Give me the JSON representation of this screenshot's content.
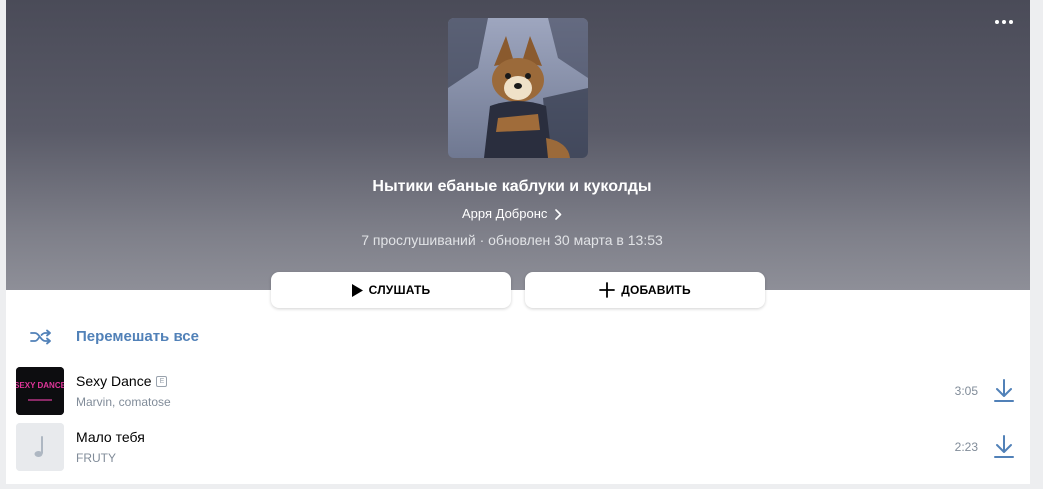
{
  "playlist": {
    "title": "Нытики ебаные каблуки и куколды",
    "owner": "Арря Добронс",
    "meta": "7 прослушиваний · обновлен 30 марта в 13:53"
  },
  "actions": {
    "play_label": "СЛУШАТЬ",
    "add_label": "ДОБАВИТЬ",
    "shuffle_label": "Перемешать все"
  },
  "tracks": [
    {
      "title": "Sexy Dance",
      "explicit_mark": "E",
      "artist": "Marvin, comatose",
      "duration": "3:05",
      "cover_text": "SEXY DANCE"
    },
    {
      "title": "Мало тебя",
      "artist": "FRUTY",
      "duration": "2:23"
    }
  ],
  "colors": {
    "accent": "#5181b8",
    "header_top": "#4a4b58",
    "header_bottom": "#8e8f98"
  },
  "icons": [
    "more-icon",
    "chevron-right-icon",
    "play-icon",
    "plus-icon",
    "shuffle-icon",
    "download-icon",
    "music-note-icon"
  ]
}
